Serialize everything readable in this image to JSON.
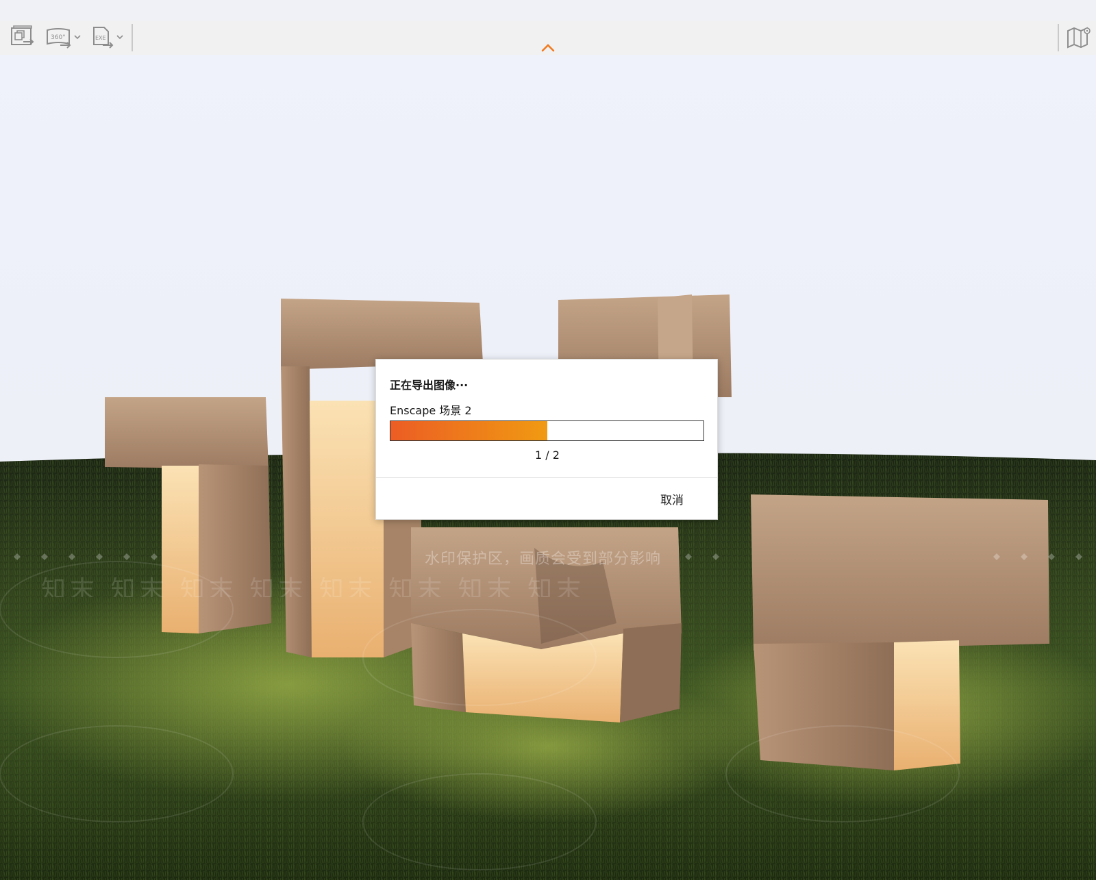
{
  "toolbar": {
    "buttons": [
      {
        "name": "batch-render-icon",
        "tooltip": ""
      },
      {
        "name": "panorama-360-export-icon",
        "label": "360°"
      },
      {
        "name": "standalone-exe-export-icon",
        "label": "EXE"
      }
    ],
    "right_button": {
      "name": "map-location-icon"
    },
    "collapse_icon": "chevron-up-icon"
  },
  "viewport": {
    "watermark_text": "水印保护区，画质会受到部分影响",
    "watermark_logo": "知末"
  },
  "export_dialog": {
    "title": "正在导出图像···",
    "subtitle": "Enscape 场景 2",
    "progress_fraction": 0.5,
    "counter": "1 / 2",
    "cancel_label": "取消"
  },
  "colors": {
    "progress_start": "#ec5d24",
    "progress_end": "#f09a12",
    "accent_orange": "#f07a20",
    "sky": "#eff1fb",
    "grass_dark": "#1e2a12",
    "stone": "#b08a6c",
    "glow": "#f7cf93"
  }
}
